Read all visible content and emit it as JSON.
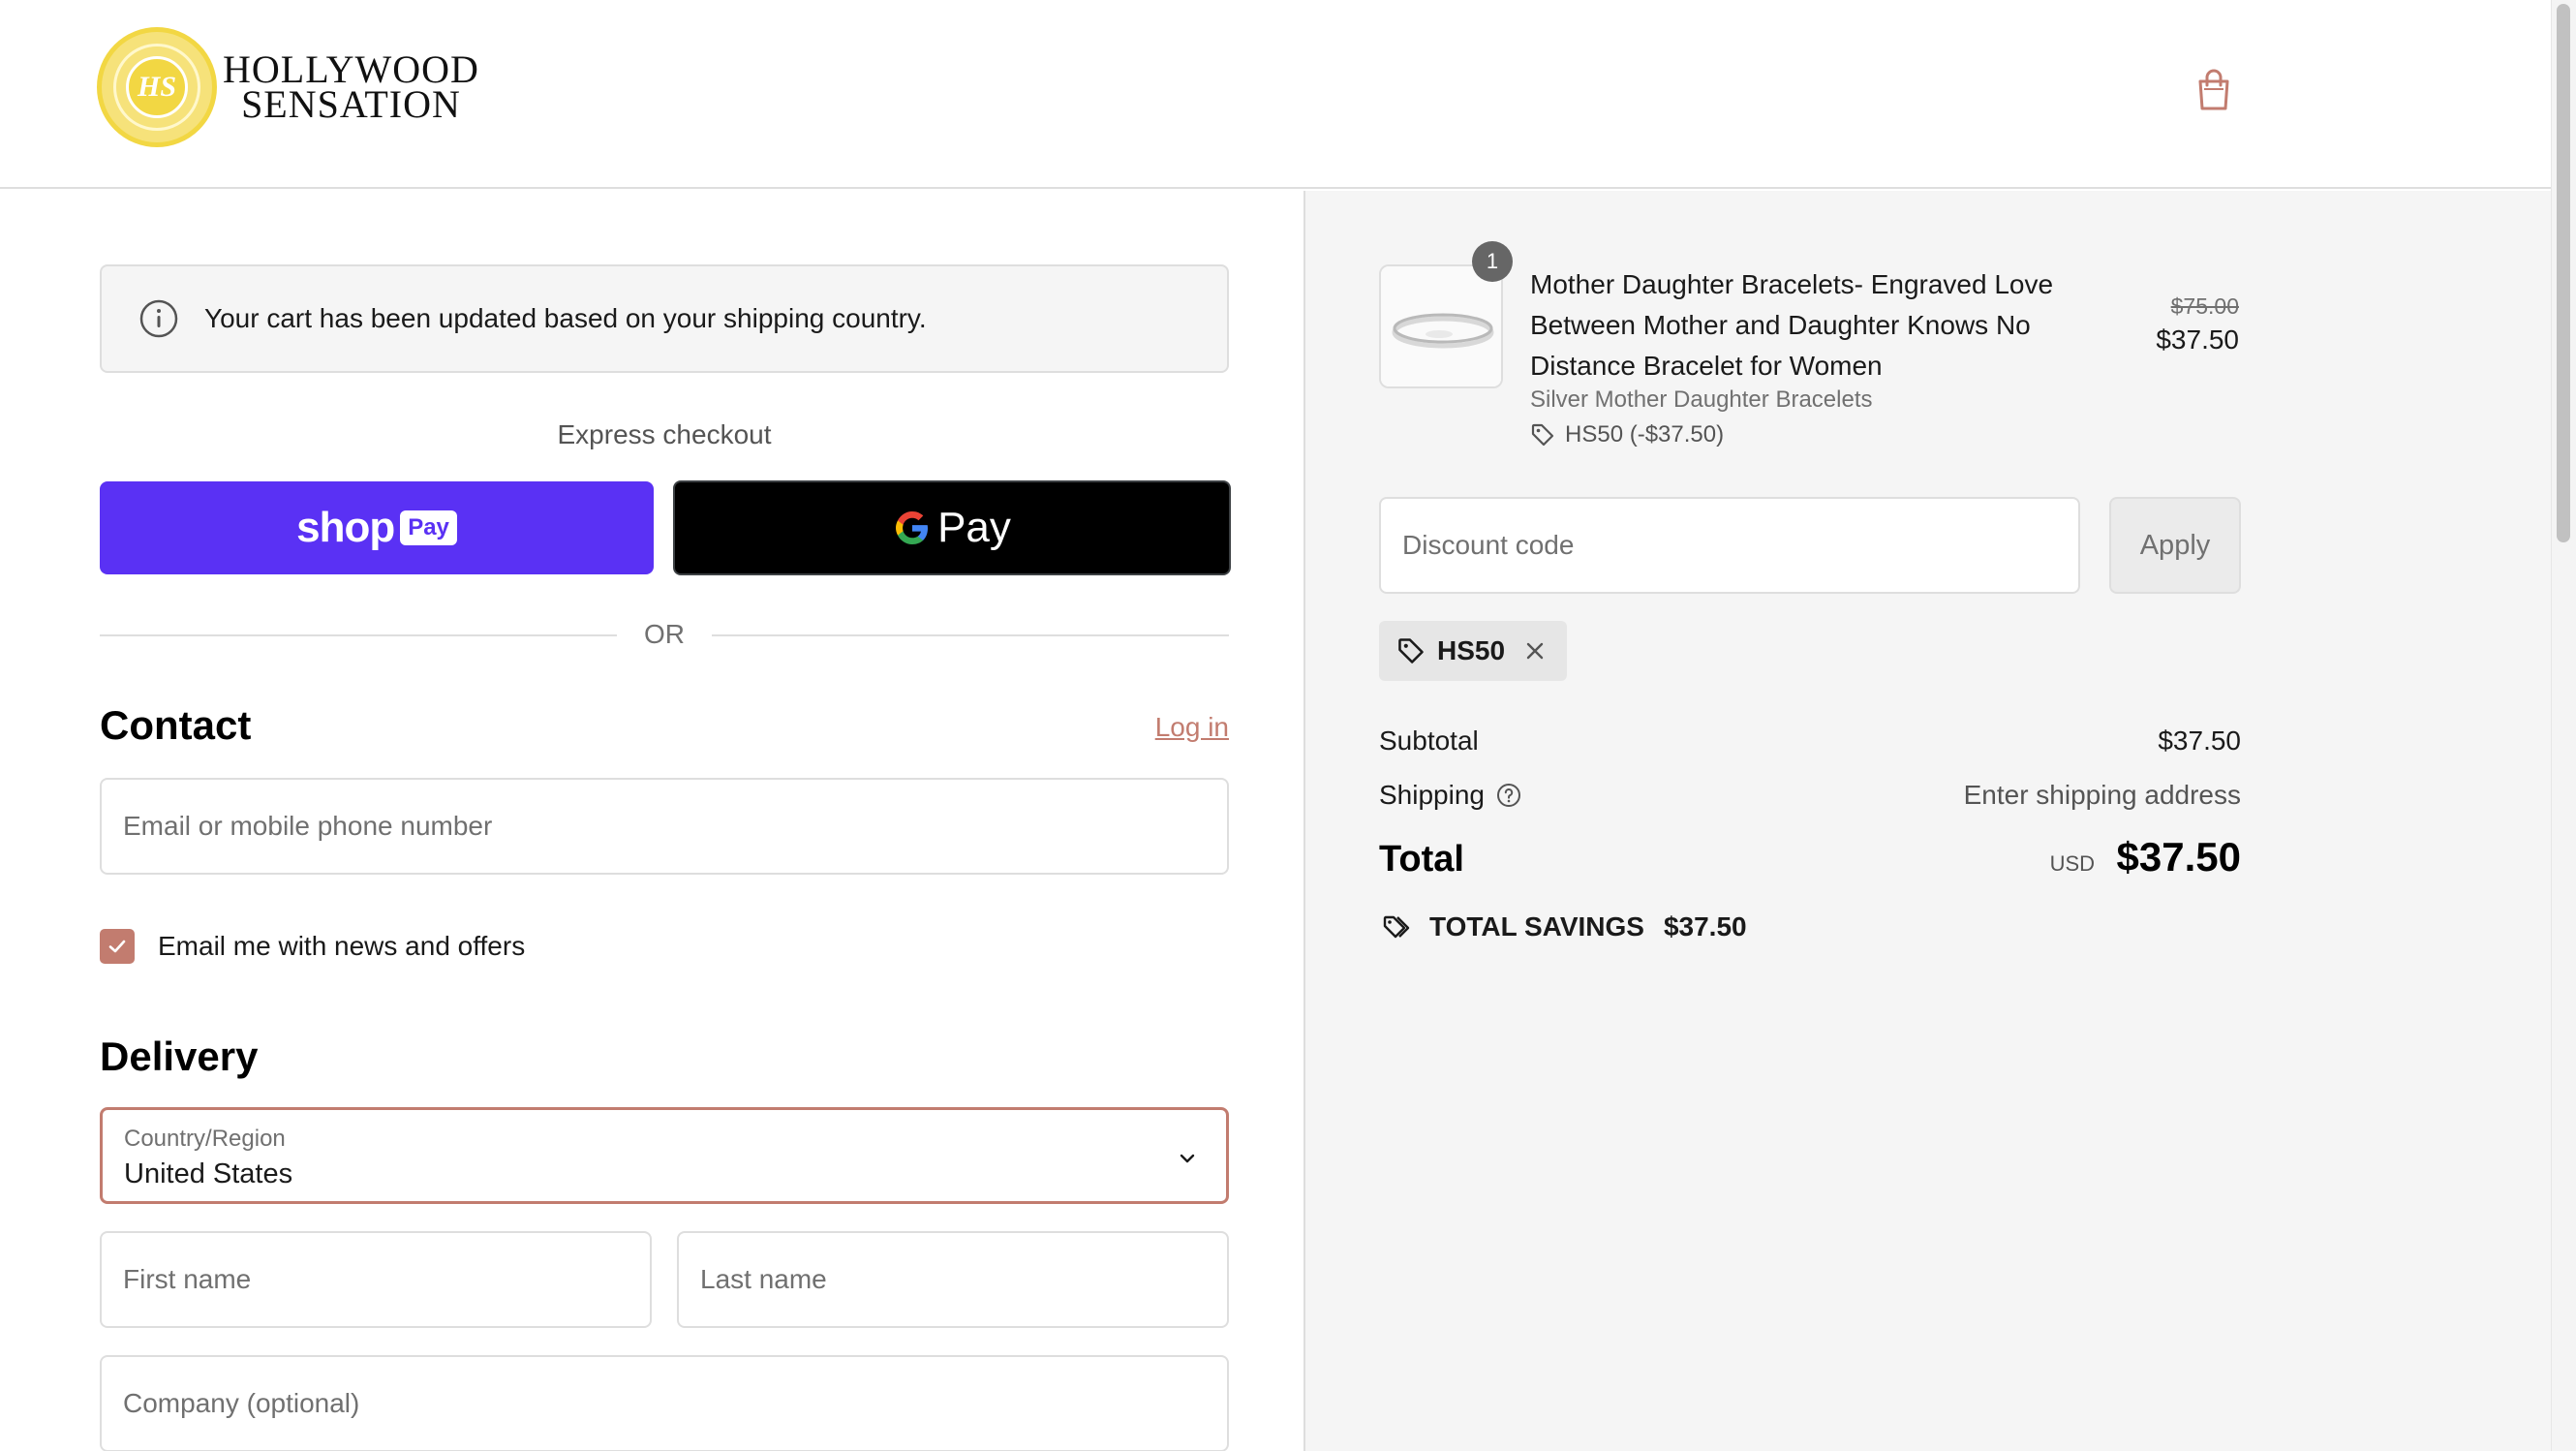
{
  "header": {
    "logo_line1": "HOLLYWOOD",
    "logo_line2": "SENSATION",
    "logo_monogram": "HS",
    "cart_icon": "shopping-bag-icon"
  },
  "notice": {
    "icon": "info-icon",
    "text": "Your cart has been updated based on your shipping country."
  },
  "express": {
    "label": "Express checkout",
    "shoppay_word": "shop",
    "shoppay_badge": "Pay",
    "gpay_word": "Pay",
    "divider": "OR"
  },
  "contact": {
    "title": "Contact",
    "login_label": "Log in",
    "email_placeholder": "Email or mobile phone number",
    "newsletter_label": "Email me with news and offers",
    "newsletter_checked": true
  },
  "delivery": {
    "title": "Delivery",
    "country_caption": "Country/Region",
    "country_value": "United States",
    "first_name_placeholder": "First name",
    "last_name_placeholder": "Last name",
    "company_placeholder": "Company (optional)"
  },
  "summary": {
    "item": {
      "quantity": "1",
      "title": "Mother Daughter Bracelets- Engraved Love Between Mother and Daughter Knows No Distance Bracelet for Women",
      "variant": "Silver Mother Daughter Bracelets",
      "discount": "HS50 (-$37.50)",
      "compare_price": "$75.00",
      "price": "$37.50"
    },
    "discount_placeholder": "Discount code",
    "apply_label": "Apply",
    "applied_code": "HS50",
    "subtotal_label": "Subtotal",
    "subtotal_value": "$37.50",
    "shipping_label": "Shipping",
    "shipping_value": "Enter shipping address",
    "total_label": "Total",
    "total_currency": "USD",
    "total_value": "$37.50",
    "savings_label": "TOTAL SAVINGS",
    "savings_value": "$37.50"
  },
  "colors": {
    "accent": "#c27c6f",
    "shoppay": "#5a31f4",
    "gpay": "#000000",
    "summary_bg": "#f5f5f5"
  }
}
